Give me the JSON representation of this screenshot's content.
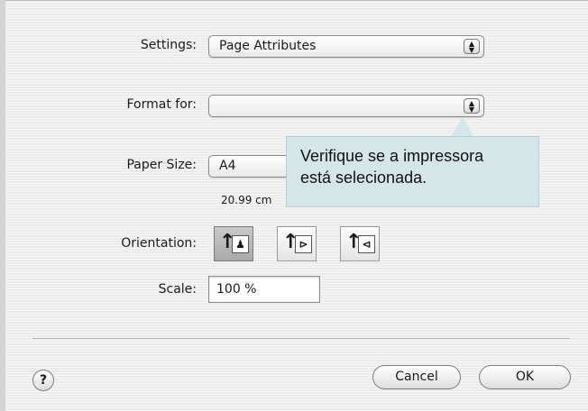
{
  "settings": {
    "label": "Settings:",
    "value": "Page Attributes"
  },
  "format_for": {
    "label": "Format for:",
    "value": ""
  },
  "paper_size": {
    "label": "Paper Size:",
    "value": "A4",
    "dimensions": "20.99 cm"
  },
  "orientation": {
    "label": "Orientation:",
    "options": [
      {
        "name": "portrait",
        "selected": true
      },
      {
        "name": "landscape-left",
        "selected": false
      },
      {
        "name": "landscape-right",
        "selected": false
      }
    ]
  },
  "scale": {
    "label": "Scale:",
    "value": "100 %"
  },
  "buttons": {
    "help": "?",
    "cancel": "Cancel",
    "ok": "OK"
  },
  "callout": {
    "line1": "Verifique se a impressora",
    "line2": "está selecionada."
  },
  "icons": {
    "popup_arrows": "up-down-arrows-icon",
    "orientation_arrow": "up-arrow-icon"
  }
}
